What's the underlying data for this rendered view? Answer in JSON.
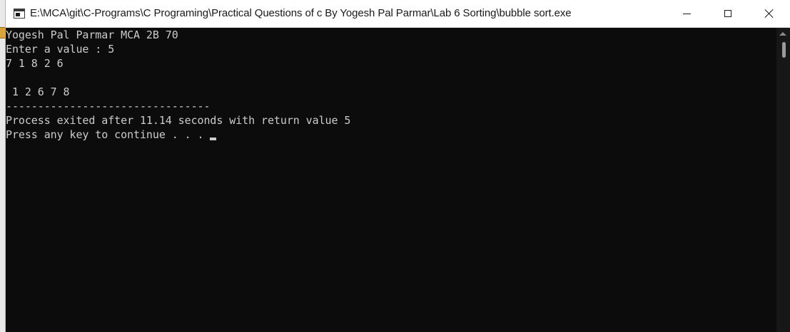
{
  "window": {
    "title": "E:\\MCA\\git\\C-Programs\\C Programing\\Practical Questions of c By Yogesh Pal Parmar\\Lab 6 Sorting\\bubble sort.exe",
    "controls": {
      "minimize": "minimize",
      "maximize": "maximize",
      "close": "close"
    }
  },
  "console": {
    "lines": [
      "Yogesh Pal Parmar MCA 2B 70",
      "Enter a value : 5",
      "7 1 8 2 6",
      "",
      " 1 2 6 7 8",
      "--------------------------------",
      "Process exited after 11.14 seconds with return value 5",
      "Press any key to continue . . . "
    ],
    "background_color": "#0c0c0c",
    "text_color": "#cccccc"
  },
  "icons": {
    "app": "console-app-icon",
    "minimize": "minimize-icon",
    "maximize": "maximize-icon",
    "close": "close-icon"
  }
}
